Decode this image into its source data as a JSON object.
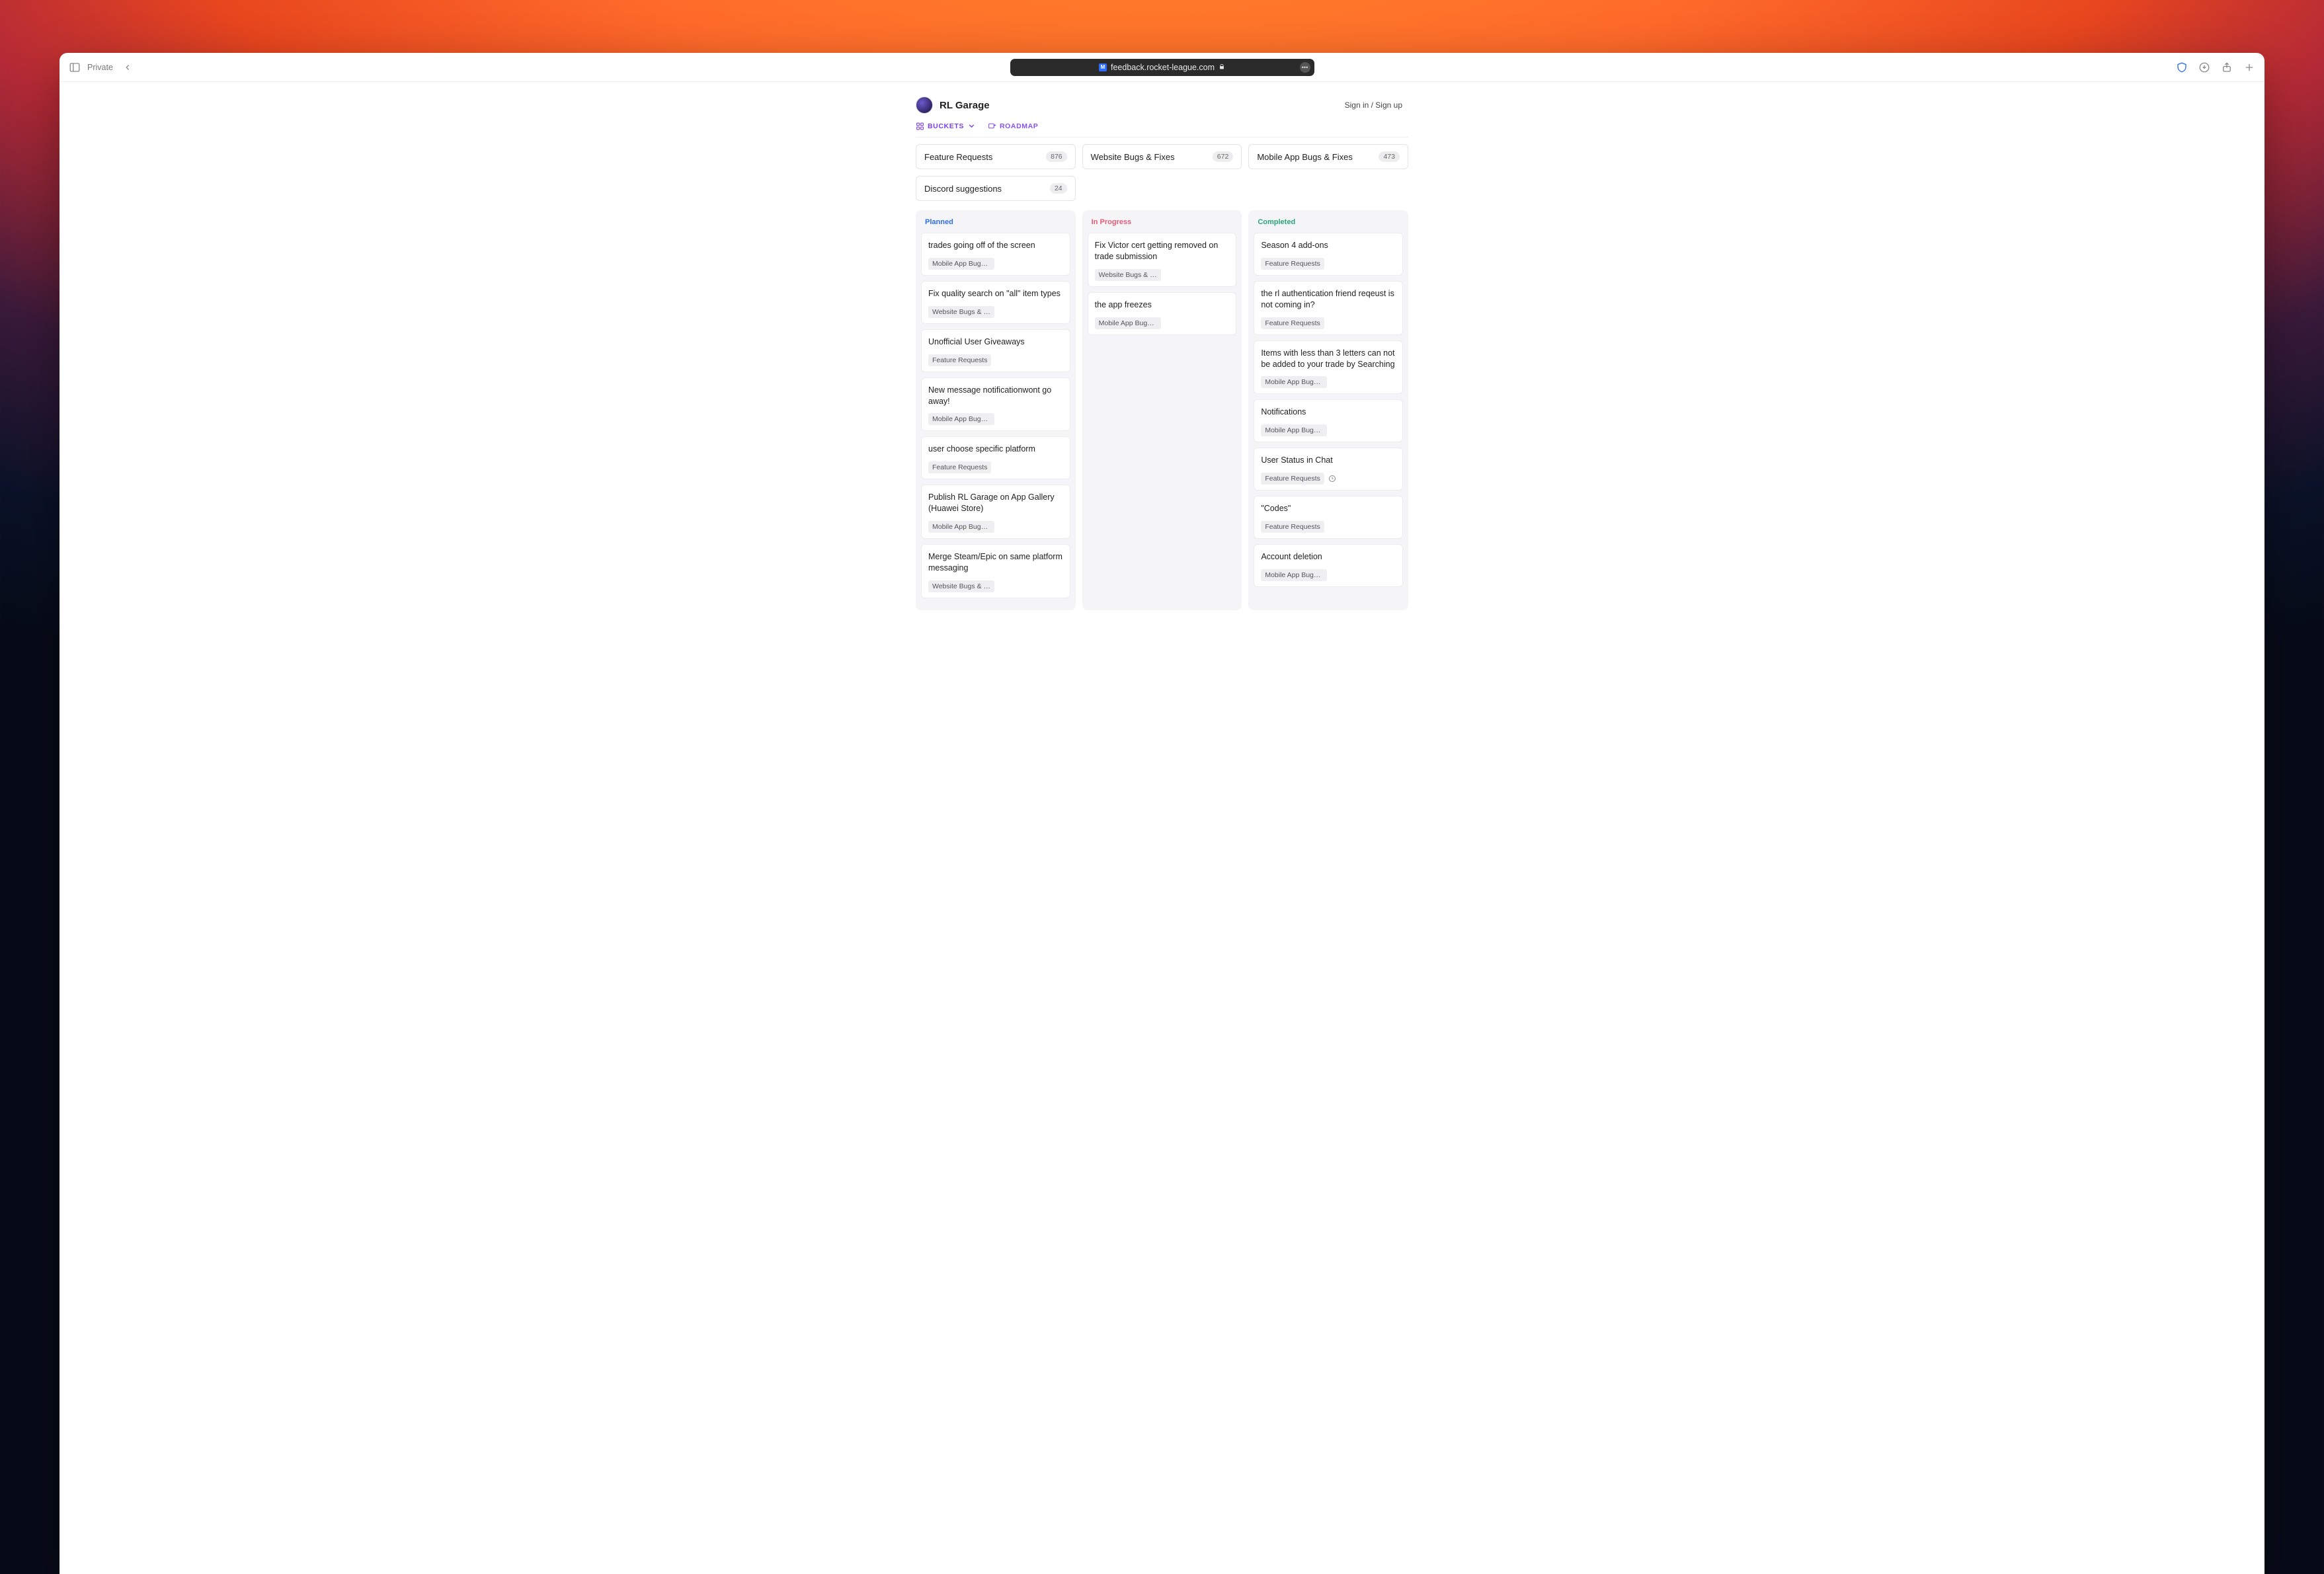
{
  "browser": {
    "private_label": "Private",
    "url": "feedback.rocket-league.com"
  },
  "header": {
    "site_title": "RL Garage",
    "signin_label": "Sign in / Sign up"
  },
  "nav": {
    "buckets_label": "BUCKETS",
    "roadmap_label": "ROADMAP"
  },
  "buckets": [
    {
      "name": "Feature Requests",
      "count": "876"
    },
    {
      "name": "Website Bugs & Fixes",
      "count": "672"
    },
    {
      "name": "Mobile App Bugs & Fixes",
      "count": "473"
    },
    {
      "name": "Discord suggestions",
      "count": "24"
    }
  ],
  "columns": {
    "planned": {
      "label": "Planned",
      "cards": [
        {
          "title": "trades going off of the screen",
          "tags": [
            "Mobile App Bugs & F…"
          ]
        },
        {
          "title": "Fix quality search on \"all\" item types",
          "tags": [
            "Website Bugs & Fixes"
          ]
        },
        {
          "title": "Unofficial User Giveaways",
          "tags": [
            "Feature Requests"
          ]
        },
        {
          "title": "New message notificationwont go away!",
          "tags": [
            "Mobile App Bugs & F…"
          ]
        },
        {
          "title": "user choose specific platform",
          "tags": [
            "Feature Requests"
          ]
        },
        {
          "title": "Publish RL Garage on App Gallery (Huawei Store)",
          "tags": [
            "Mobile App Bugs & F…"
          ]
        },
        {
          "title": "Merge Steam/Epic on same platform messaging",
          "tags": [
            "Website Bugs & Fixes"
          ]
        }
      ]
    },
    "in_progress": {
      "label": "In Progress",
      "cards": [
        {
          "title": "Fix Victor cert getting removed on trade submission",
          "tags": [
            "Website Bugs & Fixes"
          ]
        },
        {
          "title": "the app freezes",
          "tags": [
            "Mobile App Bugs & F…"
          ]
        }
      ]
    },
    "completed": {
      "label": "Completed",
      "cards": [
        {
          "title": "Season 4 add-ons",
          "tags": [
            "Feature Requests"
          ]
        },
        {
          "title": "the rl authentication friend reqeust is not coming in?",
          "tags": [
            "Feature Requests"
          ]
        },
        {
          "title": "Items with less than 3 letters can not be added to your trade by Searching",
          "tags": [
            "Mobile App Bugs & F…"
          ]
        },
        {
          "title": "Notifications",
          "tags": [
            "Mobile App Bugs & F…"
          ]
        },
        {
          "title": "User Status in Chat",
          "tags": [
            "Feature Requests"
          ],
          "clock": true
        },
        {
          "title": "\"Codes\"",
          "tags": [
            "Feature Requests"
          ]
        },
        {
          "title": "Account deletion",
          "tags": [
            "Mobile App Bugs & F…"
          ]
        }
      ]
    }
  }
}
